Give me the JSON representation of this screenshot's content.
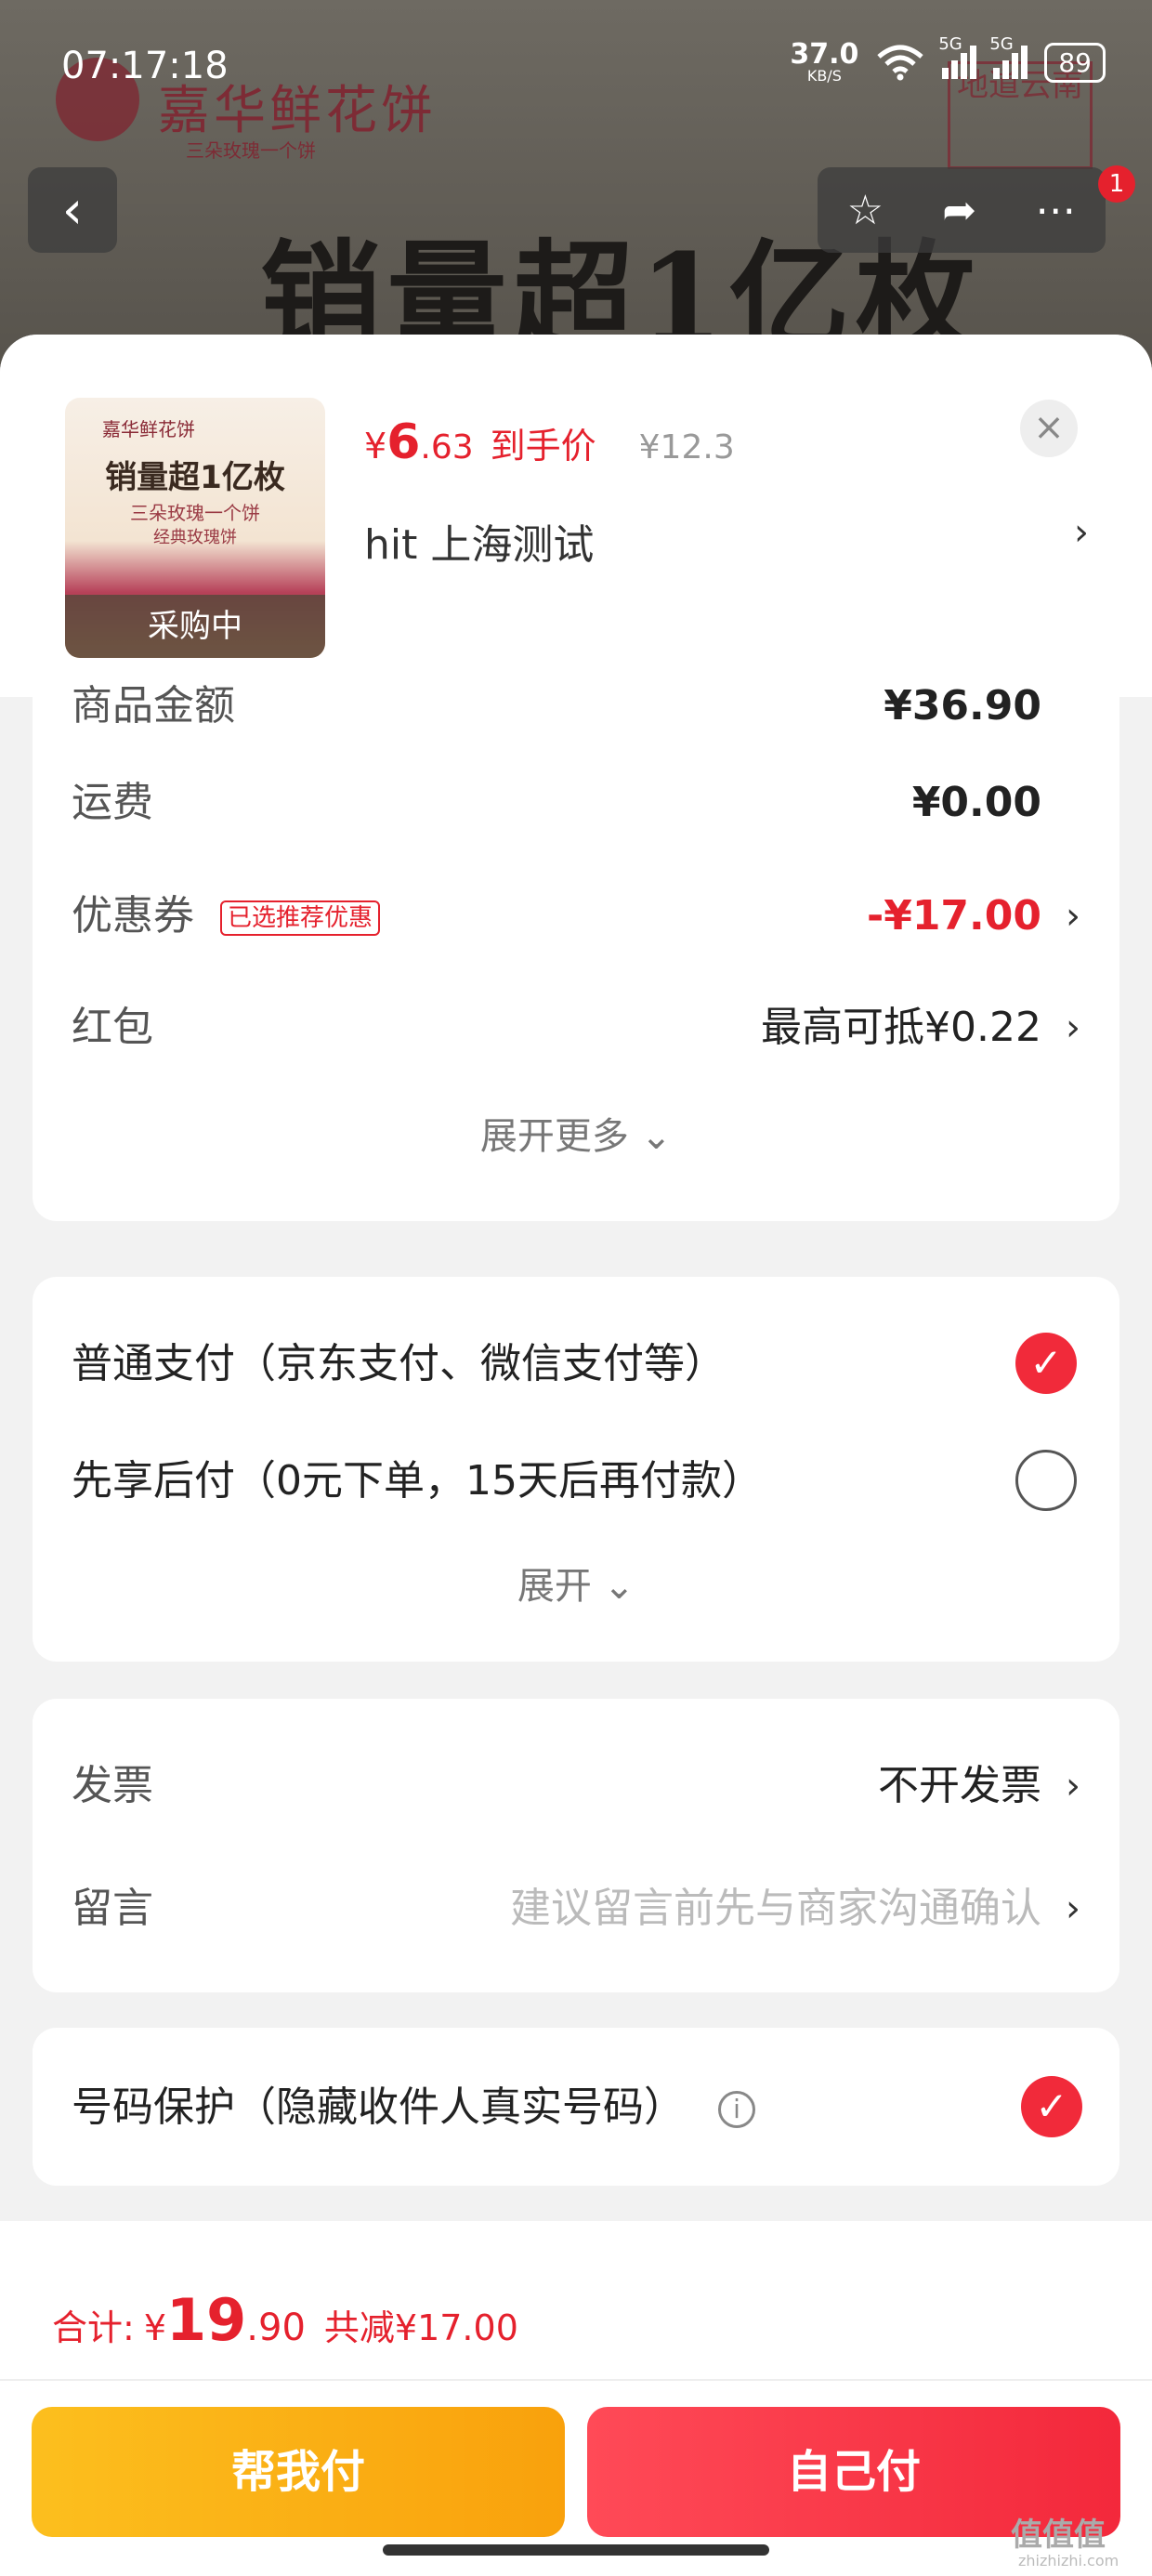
{
  "status": {
    "time": "07:17:18",
    "net_speed": "37.0",
    "net_unit": "KB/S",
    "sig1_label": "5G",
    "sig2_label": "5G",
    "battery": "89"
  },
  "background": {
    "brand_name": "嘉华鲜花饼",
    "brand_sub": "三朵玫瑰一个饼",
    "stamp": "地道云南",
    "hero_text": "销量超1亿枚",
    "nav_badge": "1"
  },
  "product": {
    "thumb_brand": "嘉华鲜花饼",
    "thumb_title": "销量超1亿枚",
    "thumb_sub1": "三朵玫瑰一个饼",
    "thumb_sub2": "经典玫瑰饼",
    "thumb_badge": "采购中",
    "price_yen": "¥",
    "price_int": "6",
    "price_dec": ".63",
    "price_tag": "到手价",
    "price_orig": "¥12.3",
    "spec": "hit  上海测试",
    "spec_arrow": "›",
    "close": "×"
  },
  "amounts": {
    "goods_label": "商品金额",
    "goods_value": "¥36.90",
    "shipping_label": "运费",
    "shipping_value": "¥0.00",
    "coupon_label": "优惠券",
    "coupon_badge": "已选推荐优惠",
    "coupon_value": "-¥17.00",
    "redpack_label": "红包",
    "redpack_value": "最高可抵¥0.22",
    "expand_more": "展开更多 ⌄",
    "chev": "›"
  },
  "payment": {
    "option1": "普通支付（京东支付、微信支付等）",
    "option1_selected": true,
    "option2": "先享后付（0元下单，15天后再付款）",
    "option2_selected": false,
    "expand": "展开 ⌄",
    "check": "✓"
  },
  "extras": {
    "invoice_label": "发票",
    "invoice_value": "不开发票",
    "note_label": "留言",
    "note_placeholder": "建议留言前先与商家沟通确认",
    "chev": "›"
  },
  "privacy": {
    "label": "号码保护（隐藏收件人真实号码）",
    "info": "i",
    "checked": true,
    "check": "✓"
  },
  "checkout": {
    "total_label": "合计:",
    "total_yen": "¥",
    "total_int": "19",
    "total_dec": ".90",
    "discount": "共减¥17.00",
    "help_pay": "帮我付",
    "self_pay": "自己付"
  },
  "watermark": {
    "main": "值值值",
    "site": "zhizhizhi.com"
  },
  "colors": {
    "accent_red": "#e5212d",
    "help_yellow": "#f9a10c",
    "self_red": "#f3283b"
  }
}
